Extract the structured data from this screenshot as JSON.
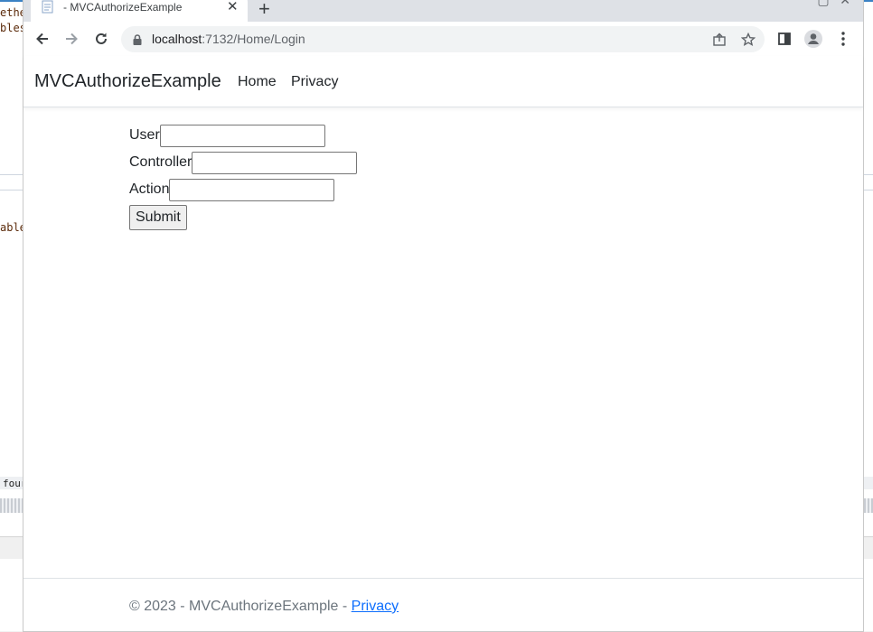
{
  "ide": {
    "code_lines": [
      "ethe",
      "bles",
      "able",
      "four"
    ]
  },
  "browser": {
    "tab_title": "- MVCAuthorizeExample",
    "url_host": "localhost",
    "url_path": ":7132/Home/Login"
  },
  "site": {
    "brand": "MVCAuthorizeExample",
    "nav": [
      "Home",
      "Privacy"
    ]
  },
  "form": {
    "user_label": "User",
    "user_value": "",
    "controller_label": "Controller",
    "controller_value": "",
    "action_label": "Action",
    "action_value": "",
    "submit_label": "Submit"
  },
  "footer": {
    "text": "© 2023 - MVCAuthorizeExample - ",
    "link": "Privacy"
  }
}
